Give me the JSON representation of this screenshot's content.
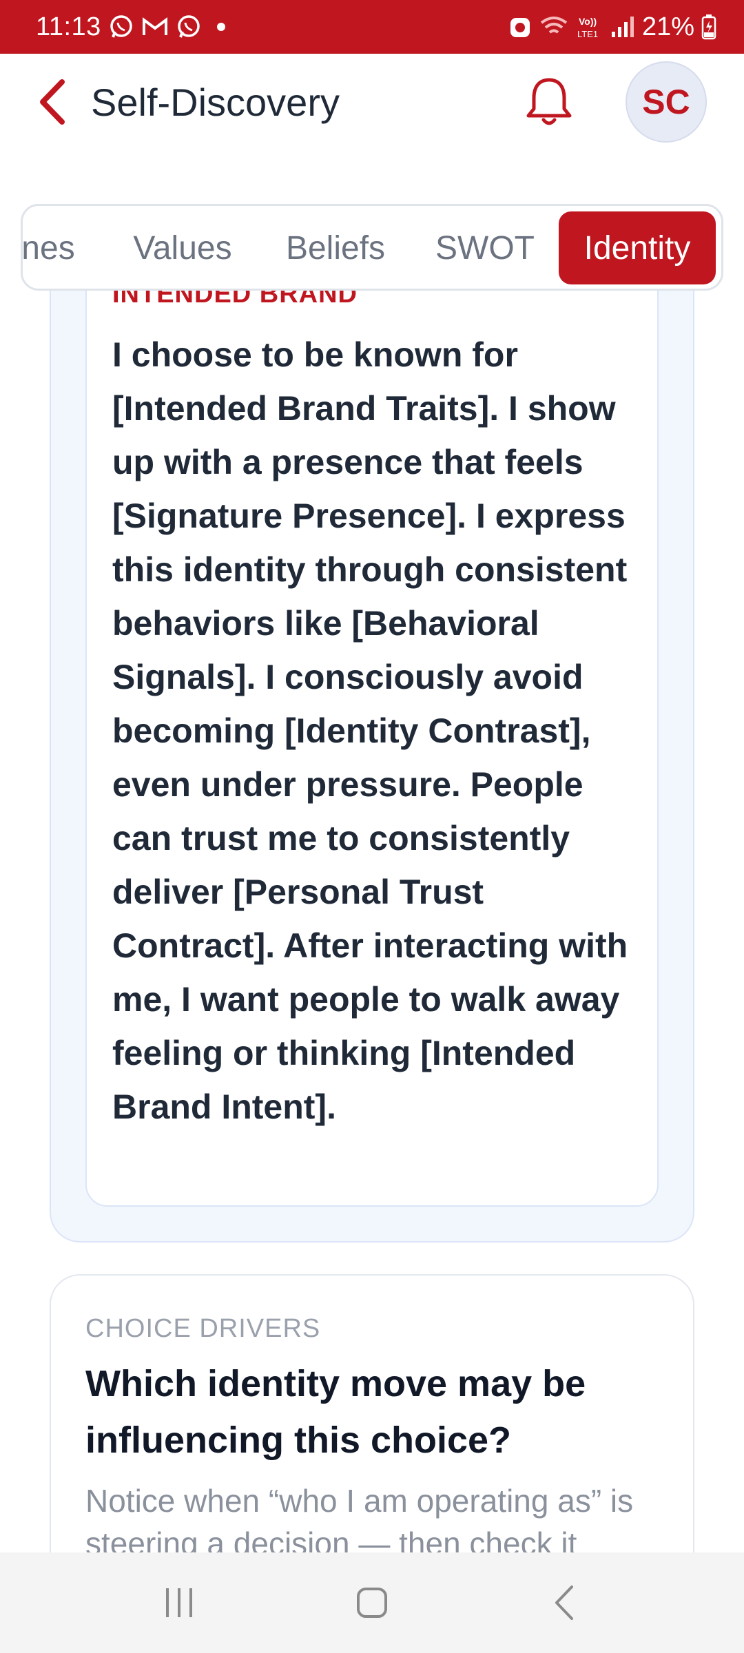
{
  "status_bar": {
    "time": "11:13",
    "battery": "21%",
    "left_icons": [
      "whatsapp-icon",
      "gmail-icon",
      "whatsapp-icon",
      "dot-icon"
    ],
    "right_icons": [
      "alarm-icon",
      "wifi-icon",
      "volte-icon",
      "signal-icon",
      "battery-icon"
    ]
  },
  "header": {
    "title": "Self-Discovery",
    "avatar_initials": "SC"
  },
  "tabs": [
    {
      "label": "nes",
      "active": false
    },
    {
      "label": "Values",
      "active": false
    },
    {
      "label": "Beliefs",
      "active": false
    },
    {
      "label": "SWOT",
      "active": false
    },
    {
      "label": "Identity",
      "active": true
    }
  ],
  "intended_brand": {
    "label": "INTENDED BRAND",
    "statement": "I choose to be known for [Intended Brand Traits]. I show up with a presence that feels [Signature Presence]. I express this identity through consistent behaviors like [Behavioral Signals]. I consciously avoid becoming [Identity Contrast], even under pressure. People can trust me to consistently deliver [Personal Trust Contract]. After interacting with me, I want people to walk away feeling or thinking [Intended Brand Intent]."
  },
  "choice_drivers": {
    "label": "CHOICE DRIVERS",
    "title": "Which identity move may be influencing this choice?",
    "description": "Notice when “who I am operating as” is steering a decision — then check it"
  },
  "colors": {
    "brand_red": "#c0161f",
    "text_dark": "#1f2937",
    "muted": "#9aa1ad"
  }
}
